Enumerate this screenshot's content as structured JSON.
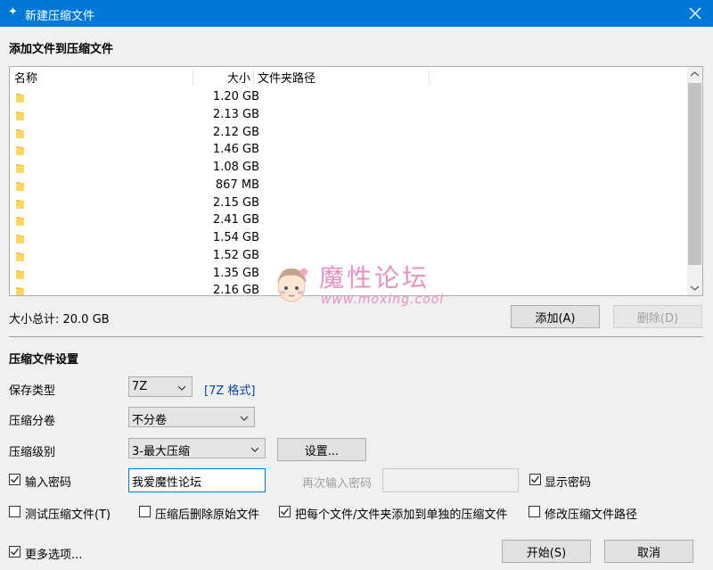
{
  "window": {
    "title": "新建压缩文件",
    "accent": "#0078d7"
  },
  "files_section": {
    "title": "添加文件到压缩文件",
    "columns": {
      "name": "名称",
      "size": "大小",
      "path": "文件夹路径"
    },
    "rows": [
      {
        "name": "",
        "size": "1.20 GB",
        "path": ""
      },
      {
        "name": "",
        "size": "2.13 GB",
        "path": ""
      },
      {
        "name": "",
        "size": "2.12 GB",
        "path": ""
      },
      {
        "name": "",
        "size": "1.46 GB",
        "path": ""
      },
      {
        "name": "",
        "size": "1.08 GB",
        "path": ""
      },
      {
        "name": "",
        "size": "867 MB",
        "path": ""
      },
      {
        "name": "",
        "size": "2.15 GB",
        "path": ""
      },
      {
        "name": "",
        "size": "2.41 GB",
        "path": ""
      },
      {
        "name": "",
        "size": "1.54 GB",
        "path": ""
      },
      {
        "name": "",
        "size": "1.52 GB",
        "path": ""
      },
      {
        "name": "",
        "size": "1.35 GB",
        "path": ""
      },
      {
        "name": "",
        "size": "2.16 GB",
        "path": ""
      }
    ],
    "total": "大小总计: 20.0 GB",
    "add_button": "添加(A)",
    "delete_button": "删除(D)"
  },
  "watermark": {
    "text": "魔性论坛",
    "url": "www.moxing.cool"
  },
  "settings": {
    "title": "压缩文件设置",
    "format_label": "保存类型",
    "format_value": "7Z",
    "format_link": "[7Z 格式]",
    "split_label": "压缩分卷",
    "split_value": "不分卷",
    "level_label": "压缩级别",
    "level_value": "3-最大压缩",
    "settings_button": "设置...",
    "password_label": "输入密码",
    "password_value": "我爱魔性论坛",
    "repeat_password_label": "再次输入密码",
    "show_password_label": "显示密码",
    "test_label": "测试压缩文件(T)",
    "delete_after_label": "压缩后删除原始文件",
    "separate_label": "把每个文件/文件夹添加到单独的压缩文件",
    "change_path_label": "修改压缩文件路径"
  },
  "footer": {
    "more_options_label": "更多选项...",
    "start_button": "开始(S)",
    "cancel_button": "取消"
  },
  "checkboxes": {
    "password": true,
    "show_password": true,
    "test": false,
    "delete_after": false,
    "separate": true,
    "change_path": false,
    "more_options": true
  }
}
